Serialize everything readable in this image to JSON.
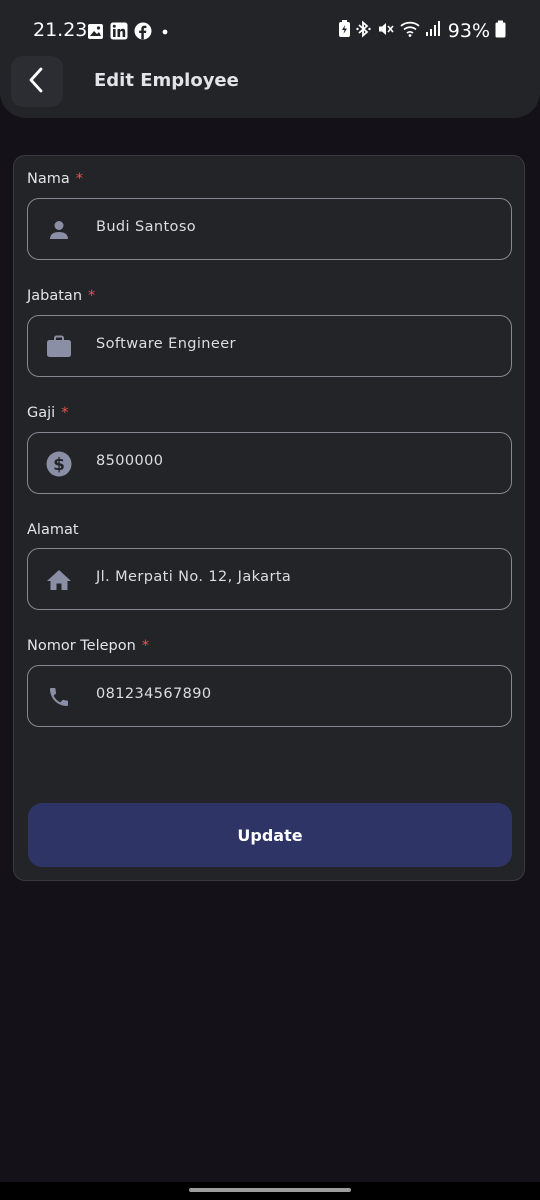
{
  "status_bar": {
    "time": "21.23",
    "battery_percent": "93%",
    "notification_icons": [
      "gallery-icon",
      "linkedin-icon",
      "facebook-icon",
      "dot-icon"
    ],
    "system_icons": [
      "battery-saver-icon",
      "bluetooth-icon",
      "mute-icon",
      "wifi-icon",
      "signal-icon",
      "battery-icon"
    ]
  },
  "app_bar": {
    "title": "Edit Employee",
    "back_icon": "chevron-left-icon"
  },
  "form": {
    "fields": [
      {
        "label": "Nama",
        "required": true,
        "value": "Budi Santoso",
        "icon": "person-icon"
      },
      {
        "label": "Jabatan",
        "required": true,
        "value": "Software Engineer",
        "icon": "briefcase-icon"
      },
      {
        "label": "Gaji",
        "required": true,
        "value": "8500000",
        "icon": "dollar-icon"
      },
      {
        "label": "Alamat",
        "required": false,
        "value": "Jl. Merpati No. 12, Jakarta",
        "icon": "home-icon"
      },
      {
        "label": "Nomor Telepon",
        "required": true,
        "value": "081234567890",
        "icon": "phone-icon"
      }
    ],
    "required_marker": "*",
    "submit_label": "Update"
  },
  "colors": {
    "background": "#141218",
    "surface": "#232428",
    "icon": "#8a8fa6",
    "required": "#e8554f",
    "button": "#2f3467",
    "outline": "#878791"
  }
}
